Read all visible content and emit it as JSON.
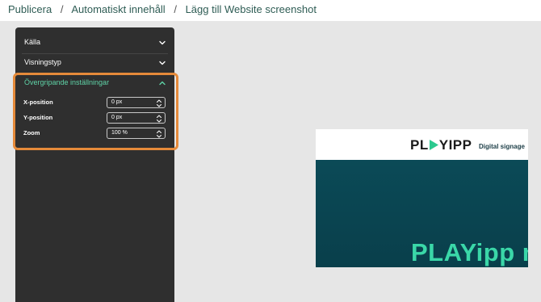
{
  "breadcrumb": {
    "items": [
      "Publicera",
      "Automatiskt innehåll",
      "Lägg till Website screenshot"
    ]
  },
  "panel": {
    "sections": [
      {
        "label": "Källa",
        "expanded": false
      },
      {
        "label": "Visningstyp",
        "expanded": false
      },
      {
        "label": "Övergripande inställningar",
        "expanded": true
      }
    ],
    "fields": [
      {
        "label": "X-position",
        "value": "0 px"
      },
      {
        "label": "Y-position",
        "value": "0 px"
      },
      {
        "label": "Zoom",
        "value": "100 %"
      }
    ]
  },
  "preview": {
    "logo_text_a": "PL",
    "logo_text_b": "YIPP",
    "nav_label": "Digital signage",
    "headline": "PLAYipp m"
  },
  "colors": {
    "accent": "#2f5d55",
    "highlight": "#e58a3a",
    "expanded_label": "#5fd3a7",
    "preview_bg": "#0b4a57",
    "headline": "#3ad7a8"
  }
}
